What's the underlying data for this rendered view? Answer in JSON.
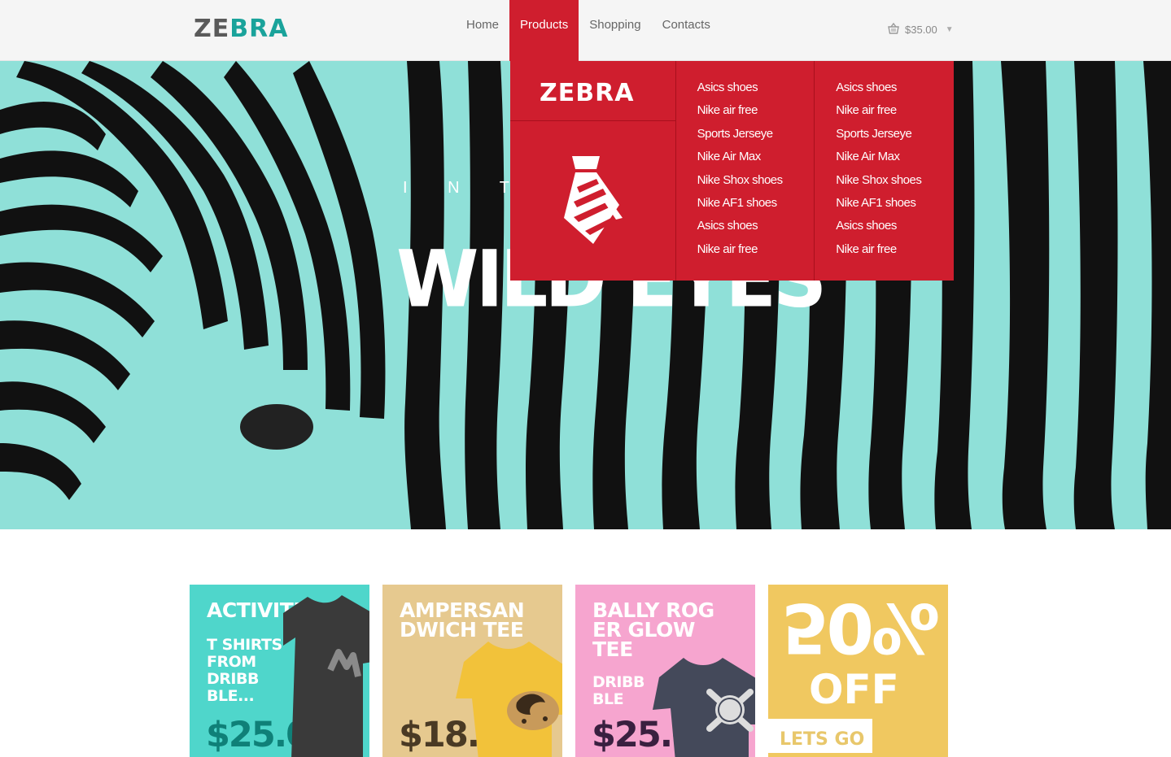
{
  "brand": {
    "part1": "ZE",
    "part2": "BRA"
  },
  "nav": {
    "items": [
      {
        "label": "Home"
      },
      {
        "label": "Products",
        "active": true
      },
      {
        "label": "Shopping"
      },
      {
        "label": "Contacts"
      }
    ]
  },
  "cart": {
    "total": "$35.00",
    "icon": "basket-icon"
  },
  "hero": {
    "intro": "I N T R",
    "headline": "WILD EYES"
  },
  "dropdown": {
    "brand": {
      "part1": "ZE",
      "part2": "BRA"
    },
    "icon": "tie-icon",
    "col1": [
      "Asics shoes",
      "Nike air free",
      "Sports Jerseye",
      "Nike Air Max",
      "Nike Shox shoes",
      "Nike AF1 shoes",
      "Asics shoes",
      "Nike air free"
    ],
    "col2": [
      "Asics shoes",
      "Nike air free",
      "Sports Jerseye",
      "Nike Air Max",
      "Nike Shox shoes",
      "Nike AF1 shoes",
      "Asics shoes",
      "Nike air free"
    ]
  },
  "promos": [
    {
      "title": "ACTIVITE",
      "subtitle": "T SHIRTS FROM DRIBB BLE...",
      "price": "$25.00",
      "color": "#4fd6cb"
    },
    {
      "title": "AMPERSAN DWICH TEE",
      "price": "$18.00",
      "color": "#e6c98f"
    },
    {
      "title": "BALLY ROG ER GLOW TEE",
      "subtitle": "DRIBB BLE",
      "price": "$25.00",
      "color": "#f6a5cf"
    },
    {
      "number": "50%",
      "off": "OFF",
      "button": "LETS GO",
      "color": "#f0c860"
    }
  ],
  "colors": {
    "accent_red": "#cf1e2e",
    "teal": "#1aa39b"
  }
}
